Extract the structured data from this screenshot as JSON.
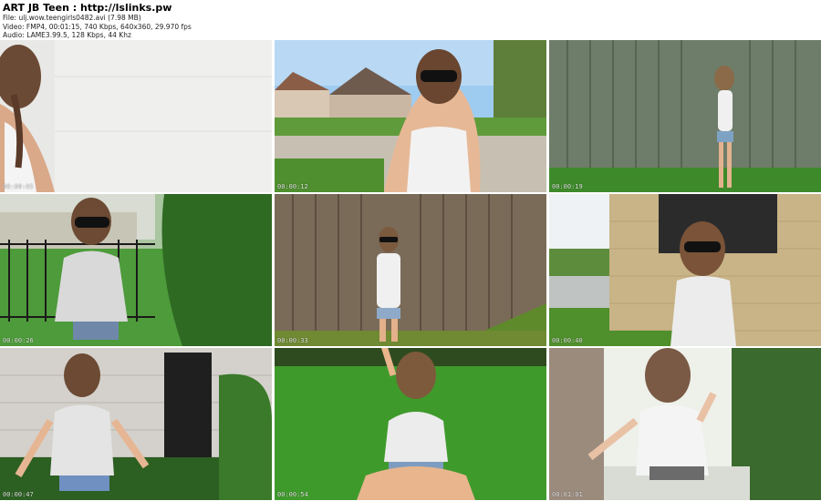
{
  "header": {
    "title": "ART JB Teen : http://lslinks.pw",
    "file_line": "File: ulj.wow.teengirls0482.avi (7.98 MB)",
    "video_line": "Video: FMP4, 00:01:15, 740 Kbps, 640x360, 29.970 fps",
    "audio_line": "Audio: LAME3.99.5, 128 Kbps, 44 Khz"
  },
  "thumbnails": [
    {
      "timestamp": "00:00:05"
    },
    {
      "timestamp": "00:00:12"
    },
    {
      "timestamp": "00:00:19"
    },
    {
      "timestamp": "00:00:26"
    },
    {
      "timestamp": "00:00:33"
    },
    {
      "timestamp": "00:00:40"
    },
    {
      "timestamp": "00:00:47"
    },
    {
      "timestamp": "00:00:54"
    },
    {
      "timestamp": "00:01:01"
    }
  ]
}
